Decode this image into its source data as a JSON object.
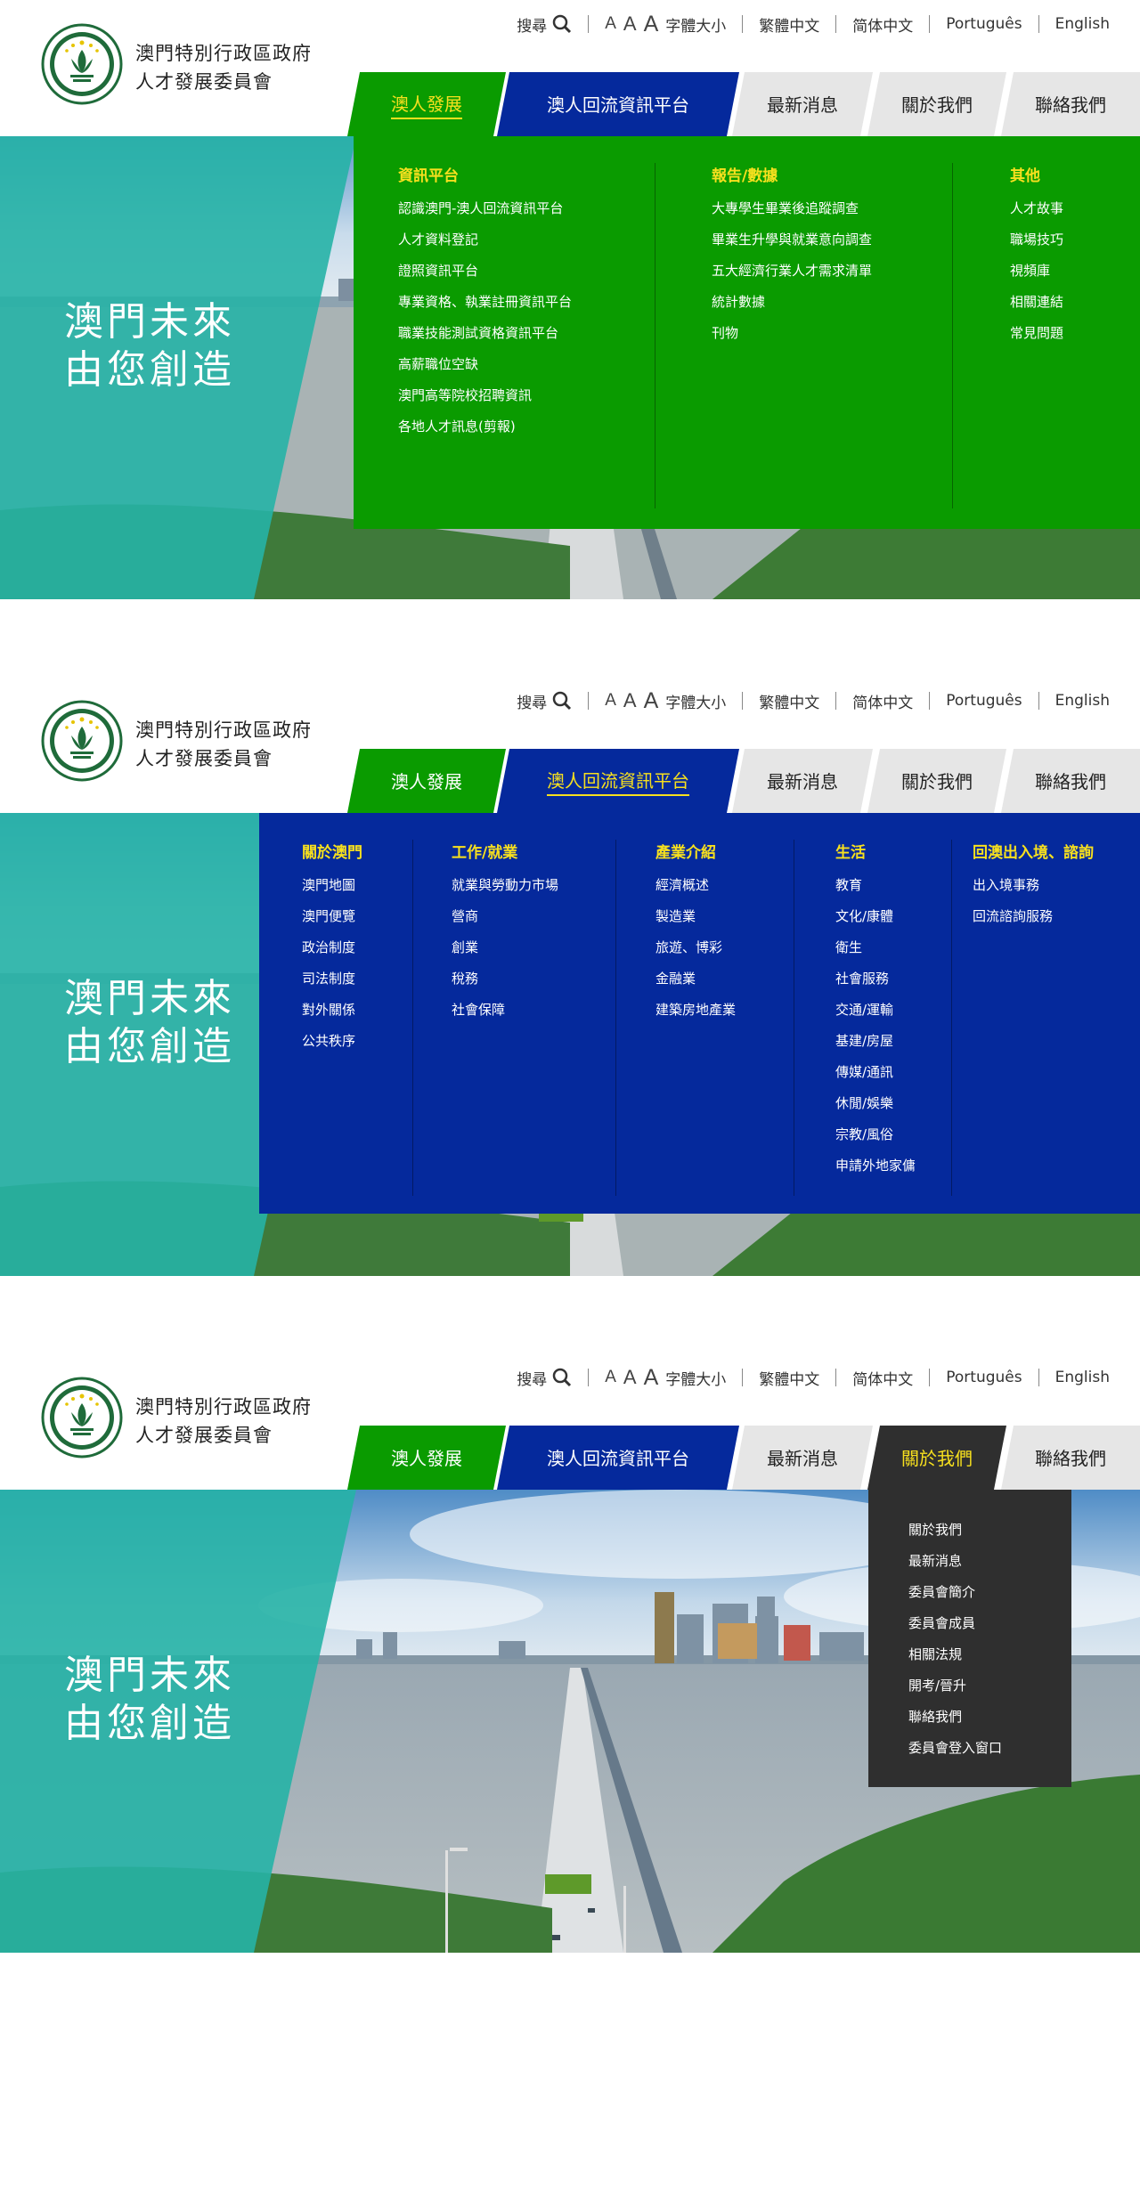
{
  "org": {
    "line1": "澳門特別行政區政府",
    "line2": "人才發展委員會"
  },
  "utility": {
    "search_label": "搜尋",
    "font_a": [
      "A",
      "A",
      "A"
    ],
    "font_size_label": "字體大小",
    "langs": [
      "繁體中文",
      "简体中文",
      "Português",
      "English"
    ]
  },
  "nav": {
    "tabs": [
      "澳人發展",
      "澳人回流資訊平台",
      "最新消息",
      "關於我們",
      "聯絡我們"
    ]
  },
  "hero": {
    "line1": "澳門未來",
    "line2": "由您創造"
  },
  "menu_dev": {
    "columns": [
      {
        "title": "資訊平台",
        "items": [
          "認識澳門-澳人回流資訊平台",
          "人才資料登記",
          "證照資訊平台",
          "專業資格、執業註冊資訊平台",
          "職業技能測試資格資訊平台",
          "高薪職位空缺",
          "澳門高等院校招聘資訊",
          "各地人才訊息(剪報)"
        ]
      },
      {
        "title": "報告/數據",
        "items": [
          "大專學生畢業後追蹤調查",
          "畢業生升學與就業意向調查",
          "五大經濟行業人才需求清單",
          "統計數據",
          "刊物"
        ]
      },
      {
        "title": "其他",
        "items": [
          "人才故事",
          "職場技巧",
          "視頻庫",
          "相關連結",
          "常見問題"
        ]
      }
    ]
  },
  "menu_return": {
    "columns": [
      {
        "title": "關於澳門",
        "items": [
          "澳門地圖",
          "澳門便覽",
          "政治制度",
          "司法制度",
          "對外關係",
          "公共秩序"
        ]
      },
      {
        "title": "工作/就業",
        "items": [
          "就業與勞動力市場",
          "營商",
          "創業",
          "稅務",
          "社會保障"
        ]
      },
      {
        "title": "產業介紹",
        "items": [
          "經濟概述",
          "製造業",
          "旅遊、博彩",
          "金融業",
          "建築房地產業"
        ]
      },
      {
        "title": "生活",
        "items": [
          "教育",
          "文化/康體",
          "衛生",
          "社會服務",
          "交通/運輸",
          "基建/房屋",
          "傳媒/通訊",
          "休閒/娛樂",
          "宗教/風俗",
          "申請外地家傭"
        ]
      },
      {
        "title": "回澳出入境、諮詢",
        "items": [
          "出入境事務",
          "回流諮詢服務"
        ]
      }
    ]
  },
  "menu_about": {
    "items": [
      "關於我們",
      "最新消息",
      "委員會簡介",
      "委員會成員",
      "相關法規",
      "開考/晉升",
      "聯絡我們",
      "委員會登入窗口"
    ]
  },
  "colors": {
    "green": "#0a9b00",
    "blue": "#05299c",
    "grey": "#e6e6e6",
    "dark": "#2f2f2f",
    "teal": "#26b2a6",
    "highlight": "#f7e01e"
  }
}
